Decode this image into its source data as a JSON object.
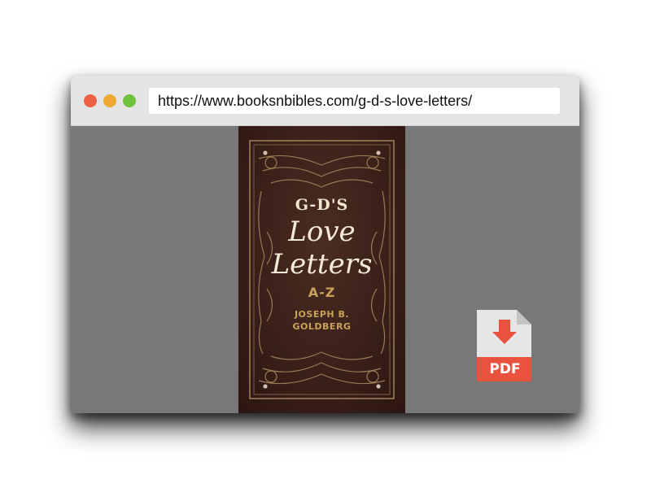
{
  "browser": {
    "url": "https://www.booksnbibles.com/g-d-s-love-letters/",
    "controls": [
      "close",
      "minimize",
      "maximize"
    ],
    "colors": {
      "close": "#ee6146",
      "minimize": "#eea934",
      "maximize": "#6fc03c"
    }
  },
  "book": {
    "title_top": "G-D'S",
    "title_script_1": "Love",
    "title_script_2": "Letters",
    "subtitle": "A-Z",
    "author_first": "JOSEPH B.",
    "author_last": "GOLDBERG"
  },
  "download": {
    "label": "PDF",
    "icon": "pdf-download-icon",
    "colors": {
      "badge": "#e8523f",
      "page": "#e6e6e6"
    }
  }
}
